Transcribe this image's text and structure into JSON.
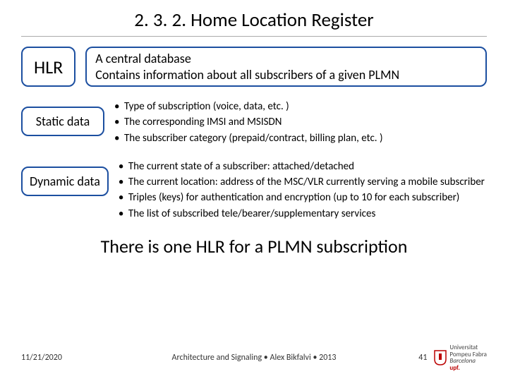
{
  "title": "2. 3. 2. Home Location Register",
  "hlr_label": "HLR",
  "intro_line1": "A central database",
  "intro_line2": "Contains information about all subscribers of a given PLMN",
  "static": {
    "label": "Static data",
    "bullets": [
      "Type of subscription (voice, data, etc. )",
      "The corresponding IMSI and MSISDN",
      "The subscriber category (prepaid/contract, billing plan, etc. )"
    ]
  },
  "dynamic": {
    "label": "Dynamic data",
    "bullets": [
      "The current state of a subscriber: attached/detached",
      "The current location: address of the MSC/VLR currently serving a mobile subscriber",
      "Triples (keys) for authentication and encryption (up to 10 for each subscriber)",
      "The list of subscribed tele/bearer/supplementary services"
    ]
  },
  "summary": "There is one HLR for a PLMN subscription",
  "footer": {
    "date": "11/21/2020",
    "center": "Architecture and Signaling • Alex Bikfalvi • 2013",
    "page": "41",
    "logo_line1": "Universitat",
    "logo_line2": "Pompeu Fabra",
    "logo_line3": "Barcelona",
    "logo_short": "upf."
  }
}
